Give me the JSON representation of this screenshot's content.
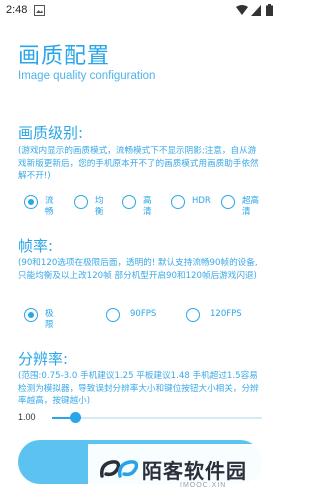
{
  "status_bar": {
    "time": "2:48"
  },
  "header": {
    "title": "画质配置",
    "subtitle": "Image quality configuration"
  },
  "quality": {
    "title": "画质级别:",
    "description": "(游戏内显示的画质模式，流畅模式下不显示阴影;注意，自从游戏新版更新后，您的手机原本开不了的画质模式用画质助手依然解不开!)",
    "options": [
      {
        "label": "流畅",
        "checked": true
      },
      {
        "label": "均衡",
        "checked": false
      },
      {
        "label": "高清",
        "checked": false
      },
      {
        "label": "HDR",
        "checked": false
      },
      {
        "label": "超高清",
        "checked": false
      }
    ]
  },
  "framerate": {
    "title": "帧率:",
    "description": "(90和120选项在极限后面，透明的! 默认支持流畅90帧的设备,只能均衡及以上改120帧 部分机型开启90和120帧后游戏闪退)",
    "options": [
      {
        "label": "极限",
        "checked": true
      },
      {
        "label": "90FPS",
        "checked": false
      },
      {
        "label": "120FPS",
        "checked": false
      }
    ]
  },
  "resolution": {
    "title": "分辨率:",
    "description": "(范围:0.75-3.0 手机建议1.25 平板建议1.48 手机超过1.5容易检测为模拟器，导致误封分辨率大小和键位按钮大小相关，分辨率越高，按键越小)",
    "value_label": "1.00",
    "value": 1.0,
    "min": 0.75,
    "max": 3.0
  },
  "watermark": {
    "text": "陌客软件园",
    "sub": "IMOOC.XIN"
  },
  "colors": {
    "accent": "#2aa6e8",
    "button": "#5cc3f0"
  }
}
